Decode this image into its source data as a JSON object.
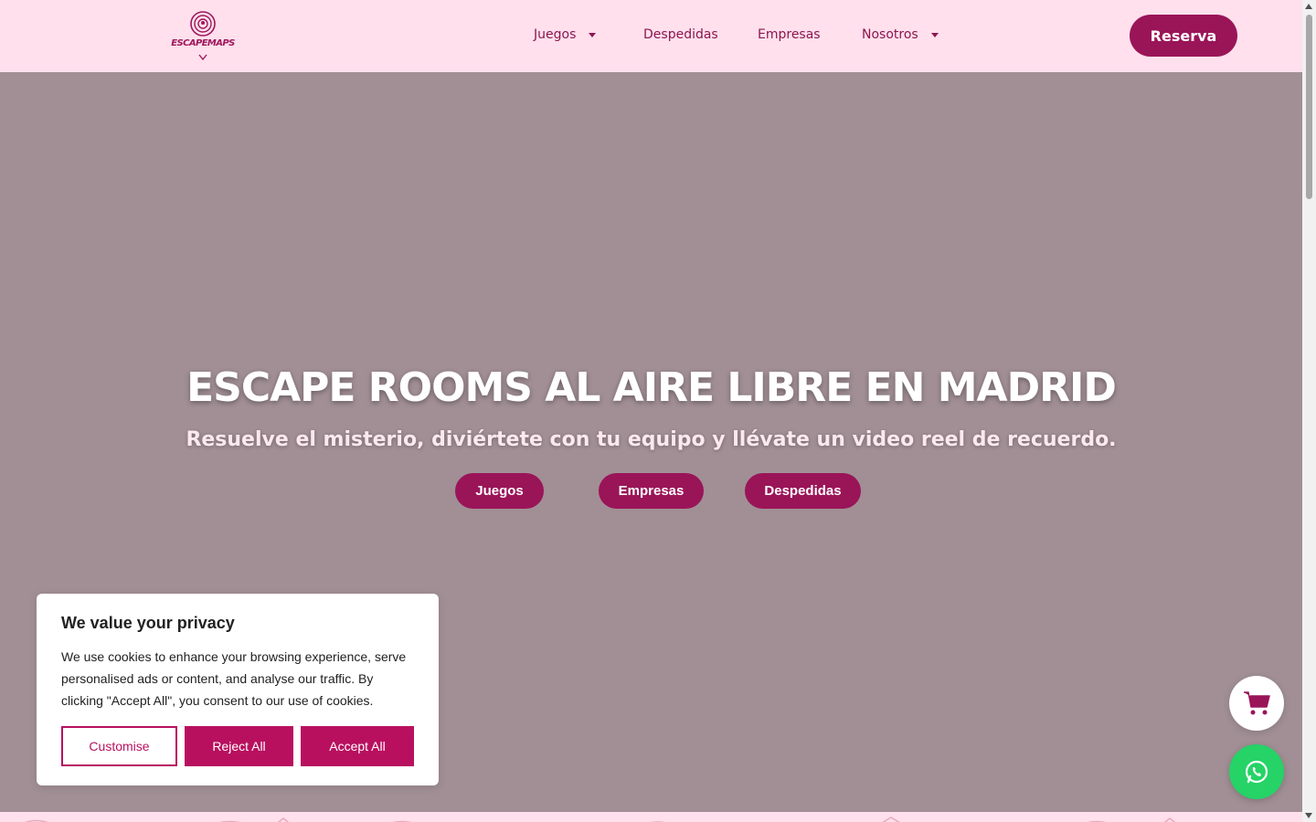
{
  "header": {
    "logo_text": "ESCAPEMAPS",
    "nav": [
      {
        "label": "Juegos",
        "has_dropdown": true
      },
      {
        "label": "Despedidas",
        "has_dropdown": false
      },
      {
        "label": "Empresas",
        "has_dropdown": false
      },
      {
        "label": "Nosotros",
        "has_dropdown": true
      }
    ],
    "cta_label": "Reserva"
  },
  "hero": {
    "title": "ESCAPE ROOMS AL AIRE LIBRE EN MADRID",
    "subtitle": "Resuelve el misterio, diviértete con tu equipo y llévate un video reel de recuerdo.",
    "buttons": [
      "Juegos",
      "Empresas",
      "Despedidas"
    ]
  },
  "cookie": {
    "title": "We value your privacy",
    "text": "We use cookies to enhance your browsing experience, serve personalised ads or content, and analyse our traffic. By clicking \"Accept All\", you consent to our use of cookies.",
    "customise_label": "Customise",
    "reject_label": "Reject All",
    "accept_label": "Accept All"
  },
  "floating": {
    "cart_icon": "cart-icon",
    "whatsapp_icon": "whatsapp-icon"
  },
  "colors": {
    "brand": "#9a1458",
    "header_bg": "#ffe0ec",
    "hero_overlay": "#a18f95",
    "whatsapp": "#25d366"
  }
}
